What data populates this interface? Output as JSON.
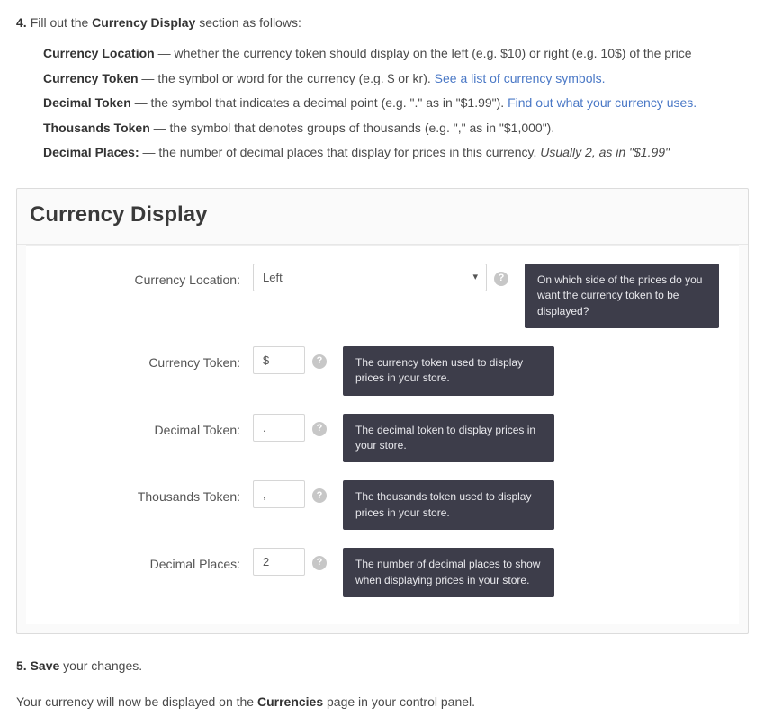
{
  "step4": {
    "num": "4.",
    "prefix": "Fill out the ",
    "bold": "Currency Display",
    "suffix": " section as follows:"
  },
  "bullets": [
    {
      "term": "Currency Location",
      "desc": " — whether the currency token should display on the left (e.g. $10) or right (e.g. 10$) of the price"
    },
    {
      "term": "Currency Token",
      "desc": " — the symbol or word for the currency (e.g. $ or kr). ",
      "link": "See a list of currency symbols."
    },
    {
      "term": "Decimal Token",
      "desc": " — the symbol that indicates a decimal point (e.g. \".\" as in \"$1.99\"). ",
      "link": "Find out what your currency uses."
    },
    {
      "term": "Thousands Token",
      "desc": " — the symbol that denotes groups of thousands (e.g. \",\" as in \"$1,000\")."
    },
    {
      "term": "Decimal Places:",
      "desc": " — the number of decimal places that display for prices in this currency. ",
      "italic": "Usually 2, as in \"$1.99\""
    }
  ],
  "panel": {
    "title": "Currency Display"
  },
  "fields": {
    "location": {
      "label": "Currency Location:",
      "value": "Left",
      "tooltip": "On which side of the prices do you want the currency token to be displayed?"
    },
    "token": {
      "label": "Currency Token:",
      "value": "$",
      "tooltip": "The currency token used to display prices in your store."
    },
    "decimal": {
      "label": "Decimal Token:",
      "value": ".",
      "tooltip": "The decimal token to display prices in your store."
    },
    "thousands": {
      "label": "Thousands Token:",
      "value": ",",
      "tooltip": "The thousands token used to display prices in your store."
    },
    "places": {
      "label": "Decimal Places:",
      "value": "2",
      "tooltip": "The number of decimal places to show when displaying prices in your store."
    }
  },
  "step5": {
    "num": "5.",
    "bold": "Save",
    "suffix": " your changes."
  },
  "closing": {
    "prefix": "Your currency will now be displayed on the ",
    "bold": "Currencies",
    "suffix": " page in your control panel."
  },
  "help_glyph": "?"
}
